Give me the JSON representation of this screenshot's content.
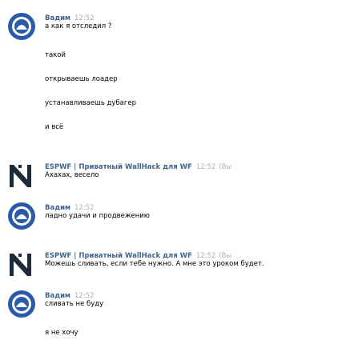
{
  "messages": [
    {
      "author": "Вадим",
      "time": "12:52",
      "avatar_icon": "user-avatar-icon",
      "lines": [
        "а как я отследил ?",
        "такой",
        "открываешь лоадер",
        "устанавливаешь дубагер",
        "и всё"
      ]
    },
    {
      "author": "ESPWF | Приватный WallHack для WF",
      "time": "12:52",
      "time_suffix": "(Вы",
      "avatar_icon": "espwf-logo-icon",
      "lines": [
        "Ахахах, весело"
      ]
    },
    {
      "author": "Вадим",
      "time": "12:52",
      "avatar_icon": "user-avatar-icon",
      "lines": [
        "ладно удачи и продвежению"
      ]
    },
    {
      "author": "ESPWF | Приватный WallHack для WF",
      "time": "12:52",
      "time_suffix": "(Вы",
      "avatar_icon": "espwf-logo-icon",
      "lines": [
        "Можешь сливать, если тебе нужно. А мне это уроком будет."
      ]
    },
    {
      "author": "Вадим",
      "time": "12:52",
      "avatar_icon": "user-avatar-icon",
      "lines": [
        "сливать не буду",
        "я не хочу"
      ]
    }
  ],
  "colors": {
    "author": "#42648b",
    "time": "#a6b1bd",
    "avatar_blue": "#2b5aa8",
    "logo_dark": "#1e2b3a"
  }
}
